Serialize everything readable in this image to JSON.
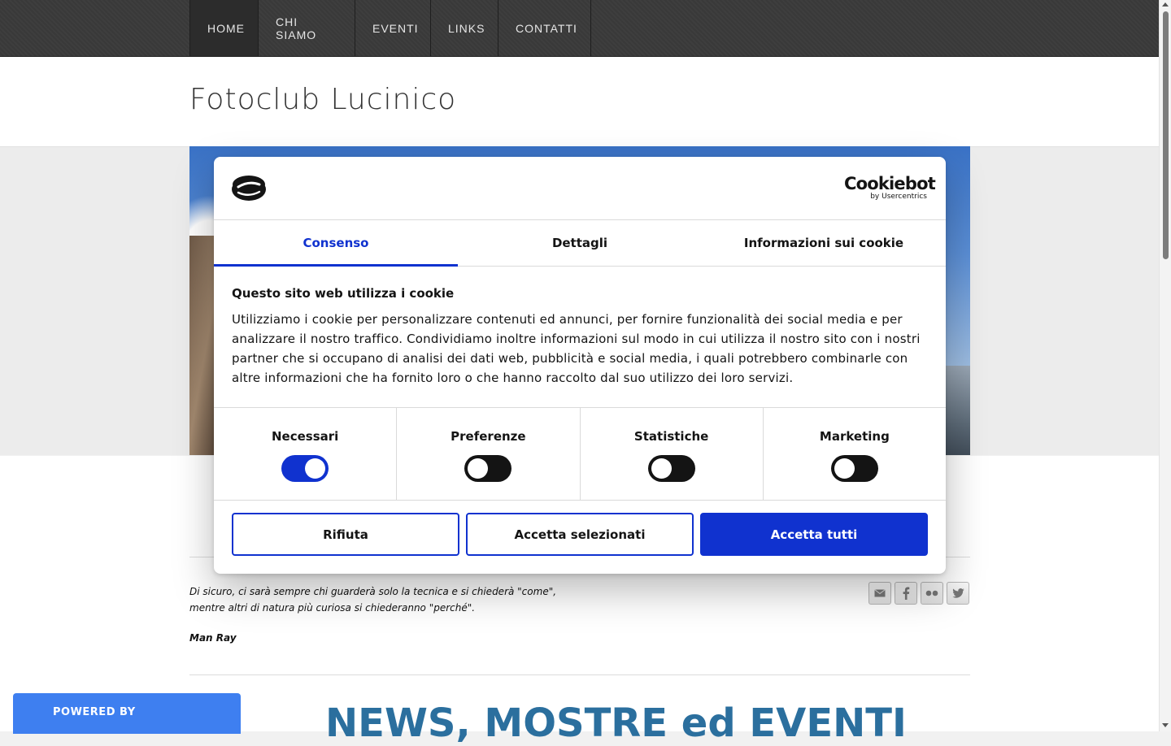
{
  "nav": {
    "items": [
      {
        "label": "HOME",
        "active": true
      },
      {
        "label": "CHI SIAMO",
        "active": false
      },
      {
        "label": "EVENTI",
        "active": false
      },
      {
        "label": "LINKS",
        "active": false
      },
      {
        "label": "CONTATTI",
        "active": false
      }
    ]
  },
  "header": {
    "title": "Fotoclub Lucinico"
  },
  "quote": {
    "line1": "Di sicuro, ci sarà sempre chi guarderà solo la tecnica e si chiederà \"come\",",
    "line2": "mentre altri di natura più curiosa si chiederanno \"perché\".",
    "author": "Man Ray"
  },
  "social": {
    "icons": [
      "email-icon",
      "facebook-icon",
      "flickr-icon",
      "twitter-icon"
    ]
  },
  "news": {
    "title": "NEWS, MOSTRE ed EVENTI"
  },
  "powered": {
    "label": "POWERED BY"
  },
  "cookie_dialog": {
    "brand": {
      "name": "Cookiebot",
      "by": "by Usercentrics"
    },
    "tabs": [
      {
        "label": "Consenso",
        "active": true
      },
      {
        "label": "Dettagli",
        "active": false
      },
      {
        "label": "Informazioni sui cookie",
        "active": false
      }
    ],
    "title": "Questo sito web utilizza i cookie",
    "text": "Utilizziamo i cookie per personalizzare contenuti ed annunci, per fornire funzionalità dei social media e per analizzare il nostro traffico. Condividiamo inoltre informazioni sul modo in cui utilizza il nostro sito con i nostri partner che si occupano di analisi dei dati web, pubblicità e social media, i quali potrebbero combinarle con altre informazioni che ha fornito loro o che hanno raccolto dal suo utilizzo dei loro servizi.",
    "toggles": [
      {
        "label": "Necessari",
        "on": true
      },
      {
        "label": "Preferenze",
        "on": false
      },
      {
        "label": "Statistiche",
        "on": false
      },
      {
        "label": "Marketing",
        "on": false
      }
    ],
    "buttons": {
      "reject": "Rifiuta",
      "accept_selected": "Accetta selezionati",
      "accept_all": "Accetta tutti"
    }
  },
  "colors": {
    "accent": "#1032cf",
    "news_title": "#2b6f9e",
    "powered_bg": "#3e7ff0",
    "nav_bg": "#3a3a3a"
  }
}
